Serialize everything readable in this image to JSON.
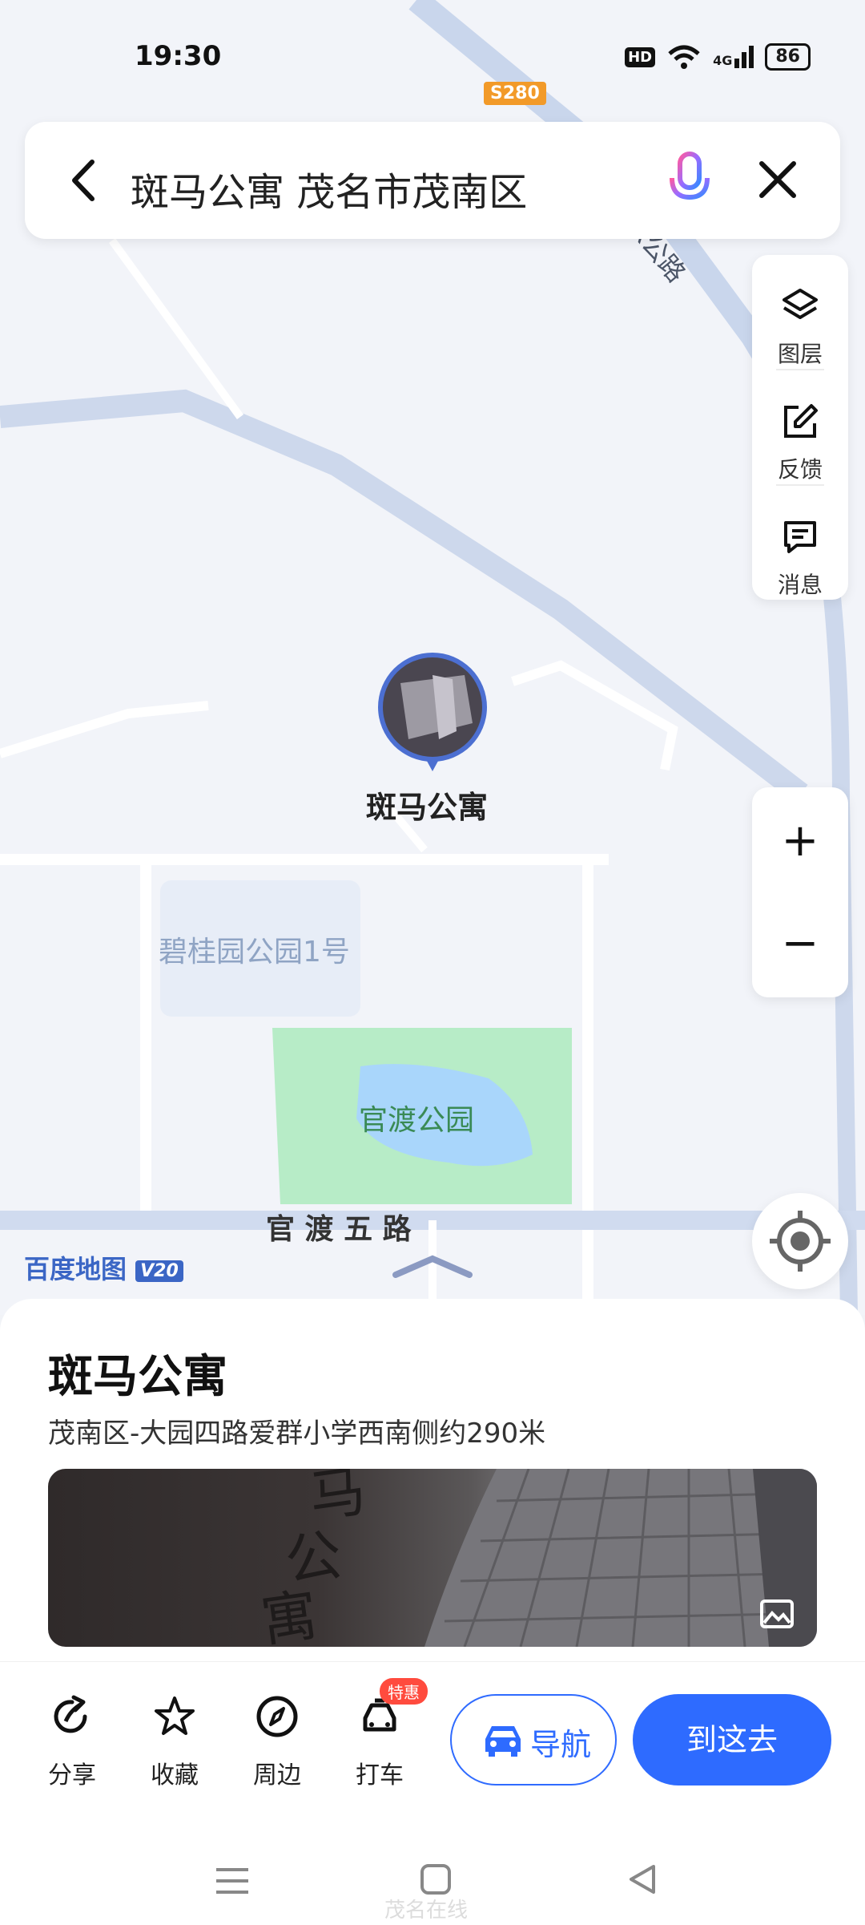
{
  "status": {
    "time": "19:30",
    "hd": "HD",
    "network": "4G",
    "battery": "86"
  },
  "search": {
    "query": "斑马公寓 茂名市茂南区"
  },
  "tools": [
    {
      "label": "图层",
      "icon": "layers-icon"
    },
    {
      "label": "反馈",
      "icon": "feedback-icon"
    },
    {
      "label": "消息",
      "icon": "message-icon"
    }
  ],
  "zoom": {
    "in": "+",
    "out": "−"
  },
  "map": {
    "road_badge": "S280",
    "road_vertical": "X公路",
    "pin_label": "斑马公寓",
    "area_label": "碧桂园公园1号",
    "park_label": "官渡公园",
    "road_label": "官 渡 五 路",
    "logo": "百度地图",
    "logo_version": "V20",
    "watermark": "茂名在线"
  },
  "poi": {
    "title": "斑马公寓",
    "address": "茂南区-大园四路爱群小学西南侧约290米"
  },
  "actions": [
    {
      "label": "分享",
      "icon": "share-icon"
    },
    {
      "label": "收藏",
      "icon": "star-icon"
    },
    {
      "label": "周边",
      "icon": "compass-icon"
    },
    {
      "label": "打车",
      "icon": "taxi-icon"
    }
  ],
  "taxi_badge": "特惠",
  "nav_button": "导航",
  "go_button": "到这去",
  "colors": {
    "accent": "#2e6bff",
    "park": "#b7ecc7",
    "water": "#a9d6fb",
    "road": "#d3ddf0"
  }
}
